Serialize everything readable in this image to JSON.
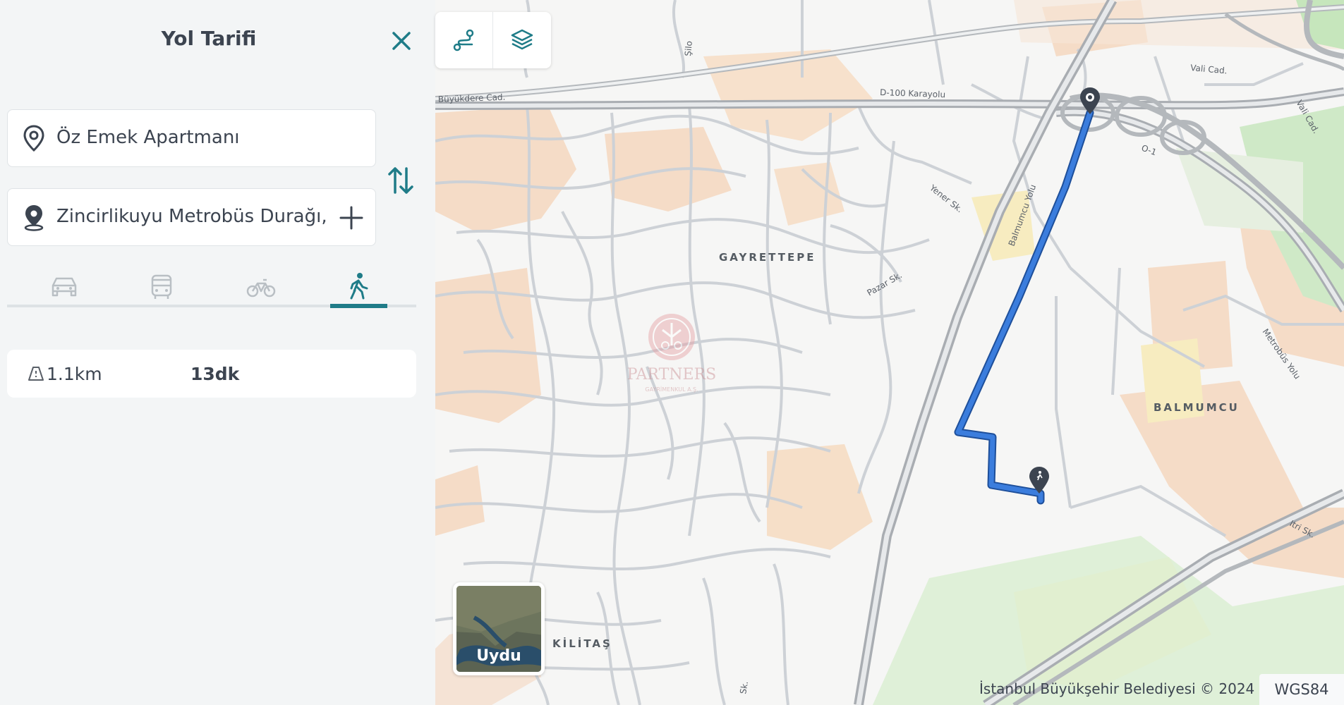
{
  "panel": {
    "title": "Yol Tarifi",
    "origin": {
      "value": "Öz Emek Apartmanı",
      "icon": "location-pin-outline-icon"
    },
    "destination": {
      "value": "Zincirlikuyu Metrobüs Durağı,",
      "icon": "location-pin-filled-icon"
    },
    "modes": [
      {
        "name": "car",
        "icon": "car-icon",
        "active": false
      },
      {
        "name": "bus",
        "icon": "bus-icon",
        "active": false
      },
      {
        "name": "bicycle",
        "icon": "bicycle-icon",
        "active": false
      },
      {
        "name": "walk",
        "icon": "walk-icon",
        "active": true
      }
    ],
    "route_summary": {
      "distance": "1.1km",
      "duration": "13dk"
    },
    "accent_color": "#1f7c88"
  },
  "map": {
    "places": {
      "gayrettepe": "GAYRETTEPE",
      "balmumcu": "BALMUMCU",
      "kilitas": "KİLİTAŞ"
    },
    "roads": {
      "d100": "D-100 Karayolu",
      "buyukdere": "Büyükdere Cad.",
      "balmumcu_yolu": "Balmumcu Yolu",
      "yener": "Yener Sk.",
      "pazar": "Pazar Sk.",
      "metrobus": "Metrobüs Yolu",
      "itri": "Itri Sk.",
      "vali": "Vali Cad.",
      "silo": "Şilo",
      "o1": "O-1",
      "sk": "Sk."
    },
    "watermark": {
      "main": "PARTNERS",
      "sub": "GAYRİMENKUL A.Ş."
    },
    "satellite_label": "Uydu",
    "attribution": "İstanbul Büyükşehir Belediyesi © 2024",
    "projection": "WGS84",
    "route_color": "#3b7ddd"
  }
}
